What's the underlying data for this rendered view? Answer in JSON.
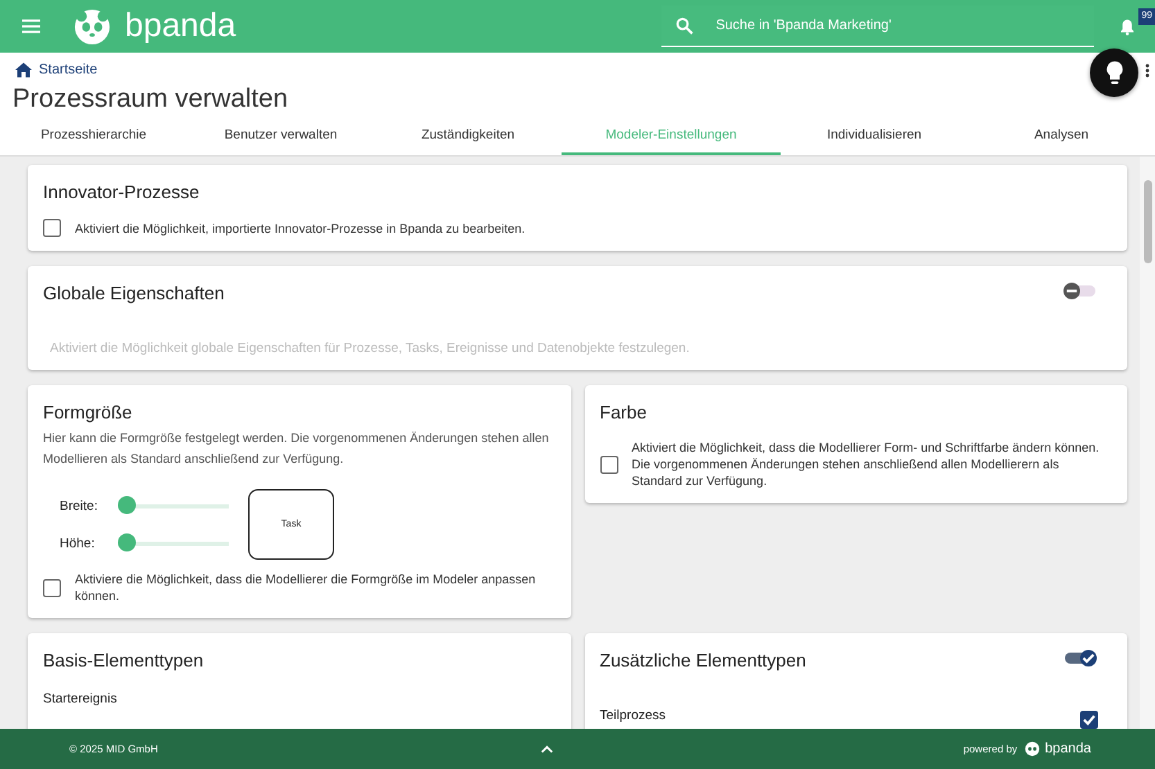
{
  "header": {
    "logo": "bpanda",
    "search": {
      "placeholder": "Suche in 'Bpanda Marketing'"
    },
    "notifications": "99"
  },
  "breadcrumb": "Startseite",
  "title": "Prozessraum verwalten",
  "tabs": [
    {
      "label": "Prozesshierarchie",
      "selected": false
    },
    {
      "label": "Benutzer verwalten",
      "selected": false
    },
    {
      "label": "Zuständigkeiten",
      "selected": false
    },
    {
      "label": "Modeler-Einstellungen",
      "selected": true
    },
    {
      "label": "Individualisieren",
      "selected": false
    },
    {
      "label": "Analysen",
      "selected": false
    }
  ],
  "innovator": {
    "title": "Innovator-Prozesse",
    "option": {
      "label": "Aktiviert die Möglichkeit, importierte Innovator-Prozesse in Bpanda zu bearbeiten.",
      "checked": false
    }
  },
  "global": {
    "title": "Globale Eigenschaften",
    "on": false,
    "description": "Aktiviert die Möglichkeit globale Eigenschaften für Prozesse, Tasks, Ereignisse und Datenobjekte festzulegen."
  },
  "form_size": {
    "title": "Formgröße",
    "description": "Hier kann die Formgröße festgelegt werden. Die vorgenommenen Änderungen stehen allen Modellieren als Standard anschließend zur Verfügung.",
    "sliders": [
      {
        "label": "Breite:",
        "level": 0.05
      },
      {
        "label": "Höhe:",
        "level": 0.05
      }
    ],
    "preview": "Task",
    "option": {
      "label": "Aktiviere die Möglichkeit, dass die Modellierer die Formgröße im Modeler anpassen können.",
      "checked": false
    }
  },
  "color": {
    "title": "Farbe",
    "option": {
      "label": "Aktiviert die Möglichkeit, dass die Modellierer Form- und Schriftfarbe ändern können. Die vorgenommenen Änderungen stehen anschließend allen Modellierern als Standard zur Verfügung.",
      "checked": false
    }
  },
  "basic_types": {
    "title": "Basis-Elementtypen",
    "items": [
      "Startereignis"
    ]
  },
  "extra_types": {
    "title": "Zusätzliche Elementtypen",
    "on": true,
    "items": [
      {
        "label": "Teilprozess",
        "checked": true
      }
    ]
  },
  "footer": {
    "copyright": "© 2025 MID GmbH",
    "powered_by": "powered by",
    "brand": "bpanda"
  }
}
